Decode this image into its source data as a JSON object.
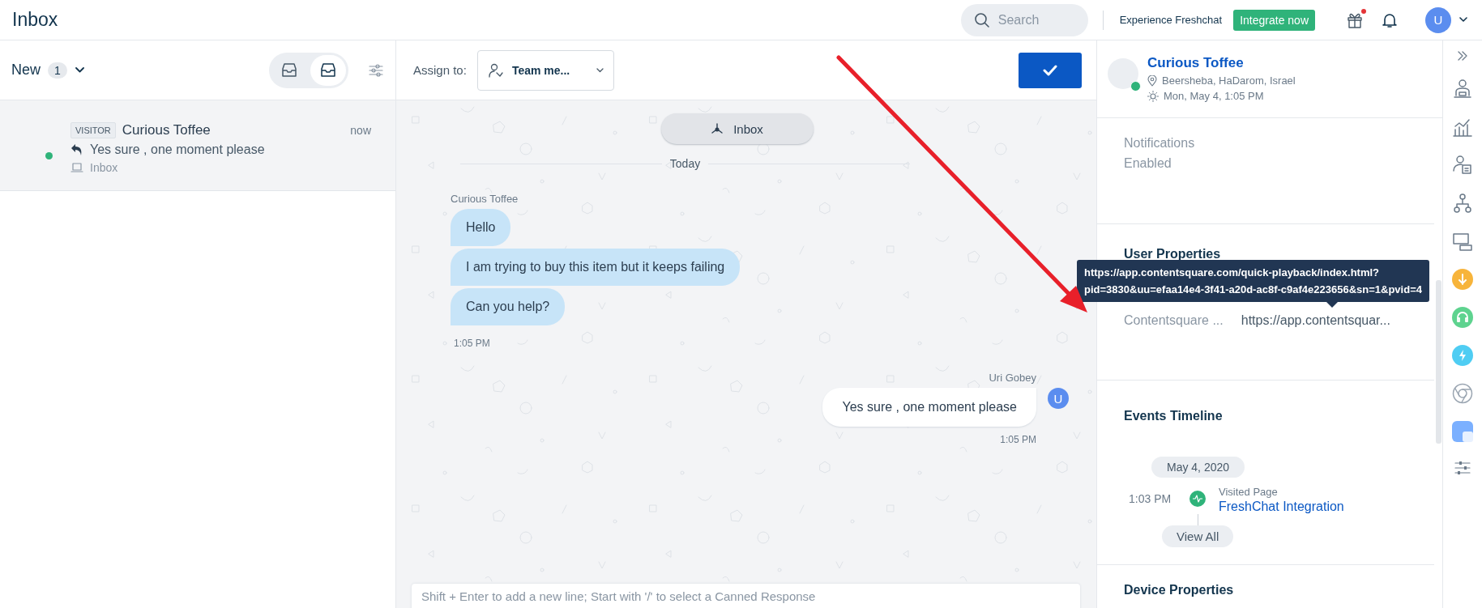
{
  "header": {
    "title": "Inbox",
    "search": {
      "placeholder": "Search"
    },
    "promo_text": "Experience Freshchat",
    "integrate_button": "Integrate now",
    "gift_badge": true,
    "avatar": "U"
  },
  "conversations_panel": {
    "filter_label": "New",
    "count": "1",
    "view_toggle": [
      {
        "selected": false
      },
      {
        "selected": true
      }
    ],
    "conversations": [
      {
        "tag": "VISITOR",
        "name": "Curious Toffee",
        "time": "now",
        "preview": "Yes sure , one moment please",
        "channel": "Inbox",
        "online": true,
        "selected": true
      }
    ]
  },
  "chat": {
    "assign_label": "Assign to:",
    "assignee": "Team me...",
    "channel_pill": "Inbox",
    "date_divider": "Today",
    "messages": [
      {
        "kind": "incoming",
        "sender": "Curious Toffee",
        "bubbles": [
          "Hello",
          "I am trying to buy this item but it keeps failing",
          "Can you help?"
        ],
        "time": "1:05 PM"
      },
      {
        "kind": "outgoing",
        "sender": "Uri Gobey",
        "avatar": "U",
        "bubbles": [
          "Yes sure , one moment please"
        ],
        "time": "1:05 PM"
      }
    ],
    "composer": {
      "placeholder": "Shift + Enter to add a new line; Start with '/' to select a Canned Response"
    }
  },
  "contact": {
    "name": "Curious Toffee",
    "online": true,
    "location": "Beersheba, HaDarom, Israel",
    "local_time": "Mon, May 4, 1:05 PM",
    "notifications_label": "Notifications Enabled",
    "user_properties": {
      "title": "User Properties",
      "properties": [
        {
          "label": "Contentsquare ...",
          "value": "https://app.contentsquar..."
        }
      ],
      "tooltip_lines": [
        "https://app.contentsquare.com/quick-playback/index.html?",
        "pid=3830&uu=efaa14e4-3f41-a20d-ac8f-c9af4e223656&sn=1&pvid=4"
      ]
    },
    "events": {
      "title": "Events Timeline",
      "date": "May 4, 2020",
      "items": [
        {
          "time": "1:03 PM",
          "type": "Visited Page",
          "title": "FreshChat Integration"
        }
      ],
      "view_all": "View All"
    },
    "device_properties": {
      "title": "Device Properties"
    }
  }
}
